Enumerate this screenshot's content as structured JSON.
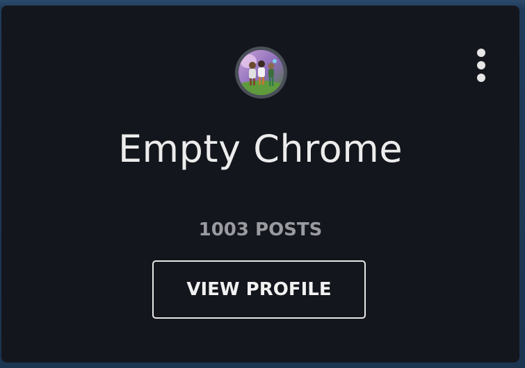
{
  "profile": {
    "name": "Empty Chrome",
    "posts_label": "1003 POSTS",
    "view_profile_label": "VIEW PROFILE",
    "avatar_icon": "community-avatar",
    "menu_icon": "more-vertical-icon"
  },
  "colors": {
    "card_background": "#14161d",
    "text_primary": "#ececec",
    "text_secondary": "#9a9ba0",
    "button_border": "#e8e8e8",
    "page_background": "#1d3a57"
  }
}
